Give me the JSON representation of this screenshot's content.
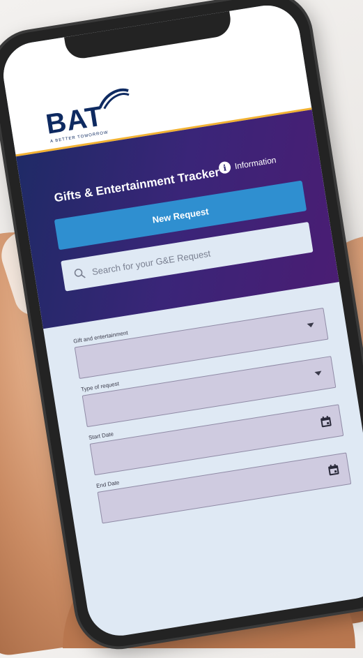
{
  "brand": {
    "logo_text": "BAT",
    "tagline": "A BETTER TOMORROW",
    "accent_color": "#f2b233",
    "primary_color": "#0e2a61"
  },
  "header": {
    "title": "Gifts & Entertainment Tracker",
    "info_label": "Information",
    "info_icon": "info-icon",
    "gradient_start": "#1f2a66",
    "gradient_end": "#4a1d73"
  },
  "actions": {
    "new_request_label": "New Request",
    "button_color": "#2f8fd0"
  },
  "search": {
    "placeholder": "Search for your G&E Request",
    "icon": "search-icon"
  },
  "form": {
    "fields": [
      {
        "label": "Gift and entertainment",
        "type": "select",
        "value": "",
        "icon": "chevron-down-icon"
      },
      {
        "label": "Type of request",
        "type": "select",
        "value": "",
        "icon": "chevron-down-icon"
      },
      {
        "label": "Start Date",
        "type": "date",
        "value": "",
        "icon": "calendar-icon"
      },
      {
        "label": "End Date",
        "type": "date",
        "value": "",
        "icon": "calendar-icon"
      }
    ]
  }
}
